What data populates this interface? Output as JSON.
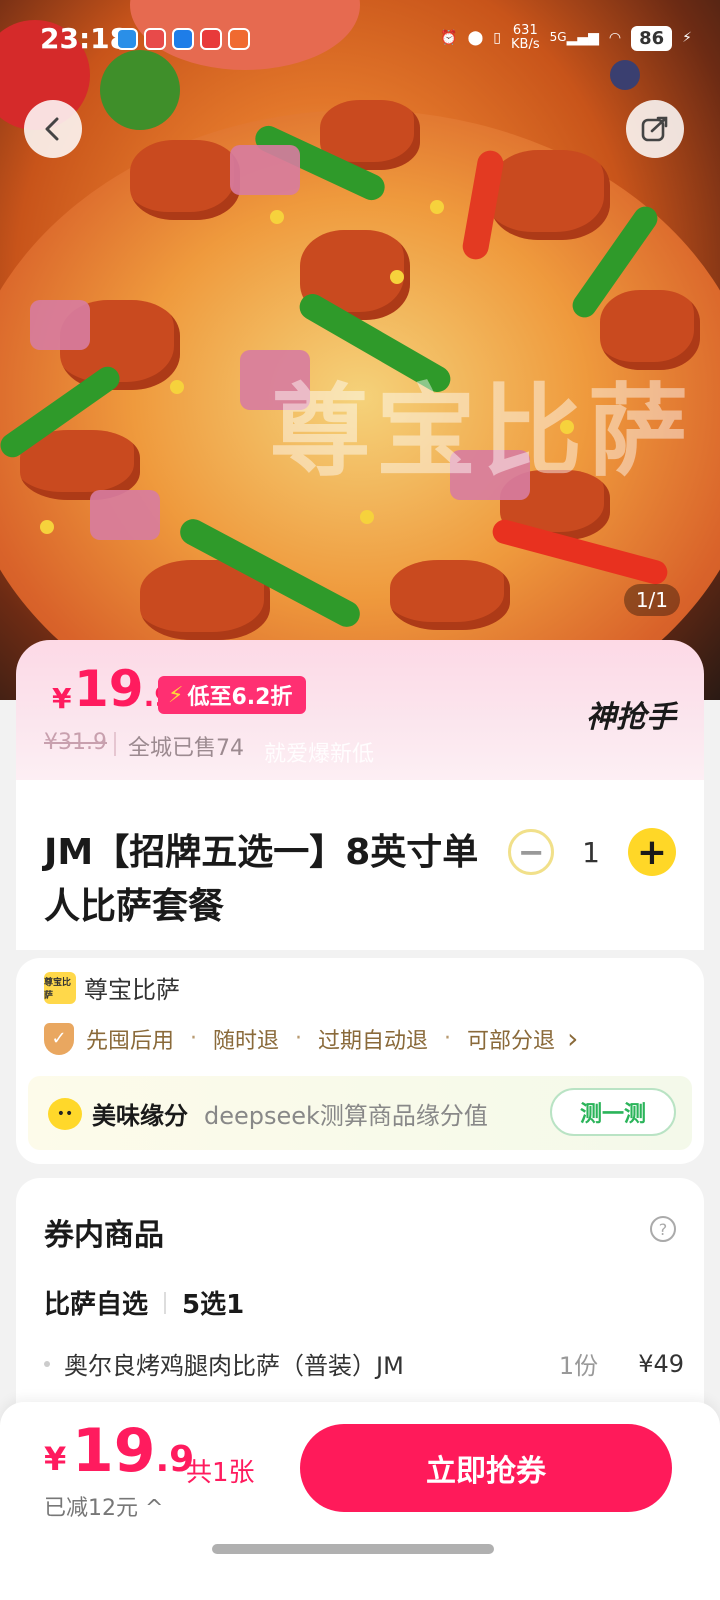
{
  "status_bar": {
    "time": "23:18",
    "network_speed": "631",
    "network_unit": "KB/s",
    "network_type": "5G",
    "battery": "86"
  },
  "hero": {
    "watermark": "尊宝比萨",
    "image_counter": "1/1"
  },
  "price_card": {
    "currency": "¥",
    "price_int": "19",
    "price_dec": ".9",
    "discount_tag": "低至6.2折",
    "original_price": "¥31.9",
    "sold_text": "全城已售74",
    "slogan": "就爱爆新低",
    "brand": "神抢手"
  },
  "product": {
    "title": "JM【招牌五选一】8英寸单人比萨套餐",
    "quantity": "1",
    "minus_symbol": "−",
    "plus_symbol": "+"
  },
  "shop": {
    "logo_text": "尊宝比萨",
    "name": "尊宝比萨",
    "guarantees": [
      "先囤后用",
      "随时退",
      "过期自动退",
      "可部分退"
    ],
    "guarantee_arrow": "›",
    "affinity_title": "美味缘分",
    "affinity_desc": "deepseek测算商品缘分值",
    "affinity_button": "测一测"
  },
  "voucher": {
    "title": "券内商品",
    "help": "?",
    "group_name": "比萨自选",
    "group_rule": "5选1",
    "items": [
      {
        "name": "奥尔良烤鸡腿肉比萨（普装）JM",
        "qty": "1份",
        "price": "¥49"
      }
    ]
  },
  "bottom_bar": {
    "currency": "¥",
    "price_int": "19",
    "price_dec": ".9",
    "count": "共1张",
    "saved": "已减12元 ^",
    "cta": "立即抢券"
  },
  "colors": {
    "accent": "#ff1b5e",
    "stepper_plus": "#ffd727",
    "affinity_green": "#2bb45a"
  }
}
